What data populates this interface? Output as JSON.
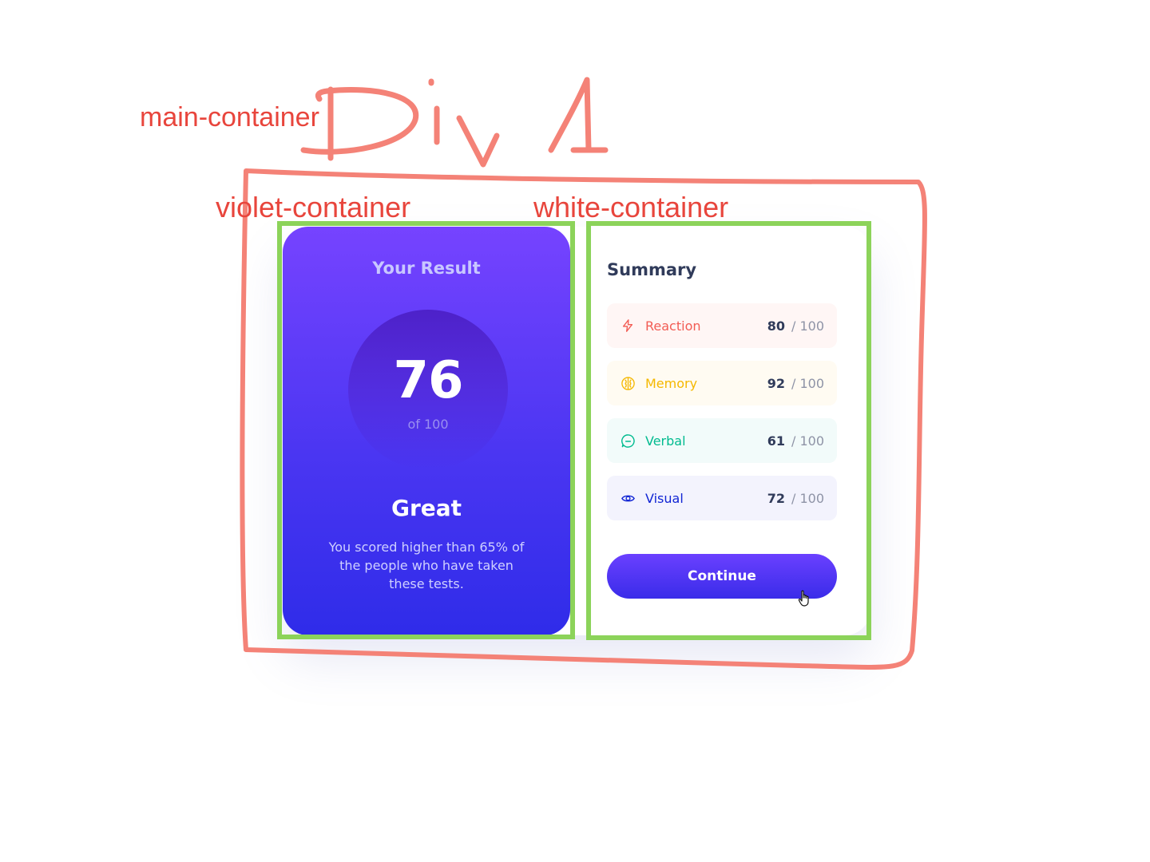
{
  "annotations": {
    "main_label": "main-container",
    "violet_label": "violet-container",
    "white_label": "white-container",
    "handwritten_title": "Div 1"
  },
  "result": {
    "heading": "Your Result",
    "score": "76",
    "score_of": "of 100",
    "rating": "Great",
    "description": "You scored higher than 65% of the people who have taken these tests."
  },
  "summary": {
    "heading": "Summary",
    "items": [
      {
        "label": "Reaction",
        "score": "80",
        "total": "/ 100",
        "icon": "lightning-icon",
        "color": "#f25c54"
      },
      {
        "label": "Memory",
        "score": "92",
        "total": "/ 100",
        "icon": "brain-icon",
        "color": "#f5b800"
      },
      {
        "label": "Verbal",
        "score": "61",
        "total": "/ 100",
        "icon": "chat-bubble-icon",
        "color": "#00bb8f"
      },
      {
        "label": "Visual",
        "score": "72",
        "total": "/ 100",
        "icon": "eye-icon",
        "color": "#1125d4"
      }
    ],
    "continue_label": "Continue"
  },
  "colors": {
    "annotation_red": "#e8453c",
    "annotation_box_red": "#f48277",
    "annotation_box_green": "#8cd35a",
    "violet_top": "#7643ff",
    "violet_bottom": "#2f2ce9"
  }
}
